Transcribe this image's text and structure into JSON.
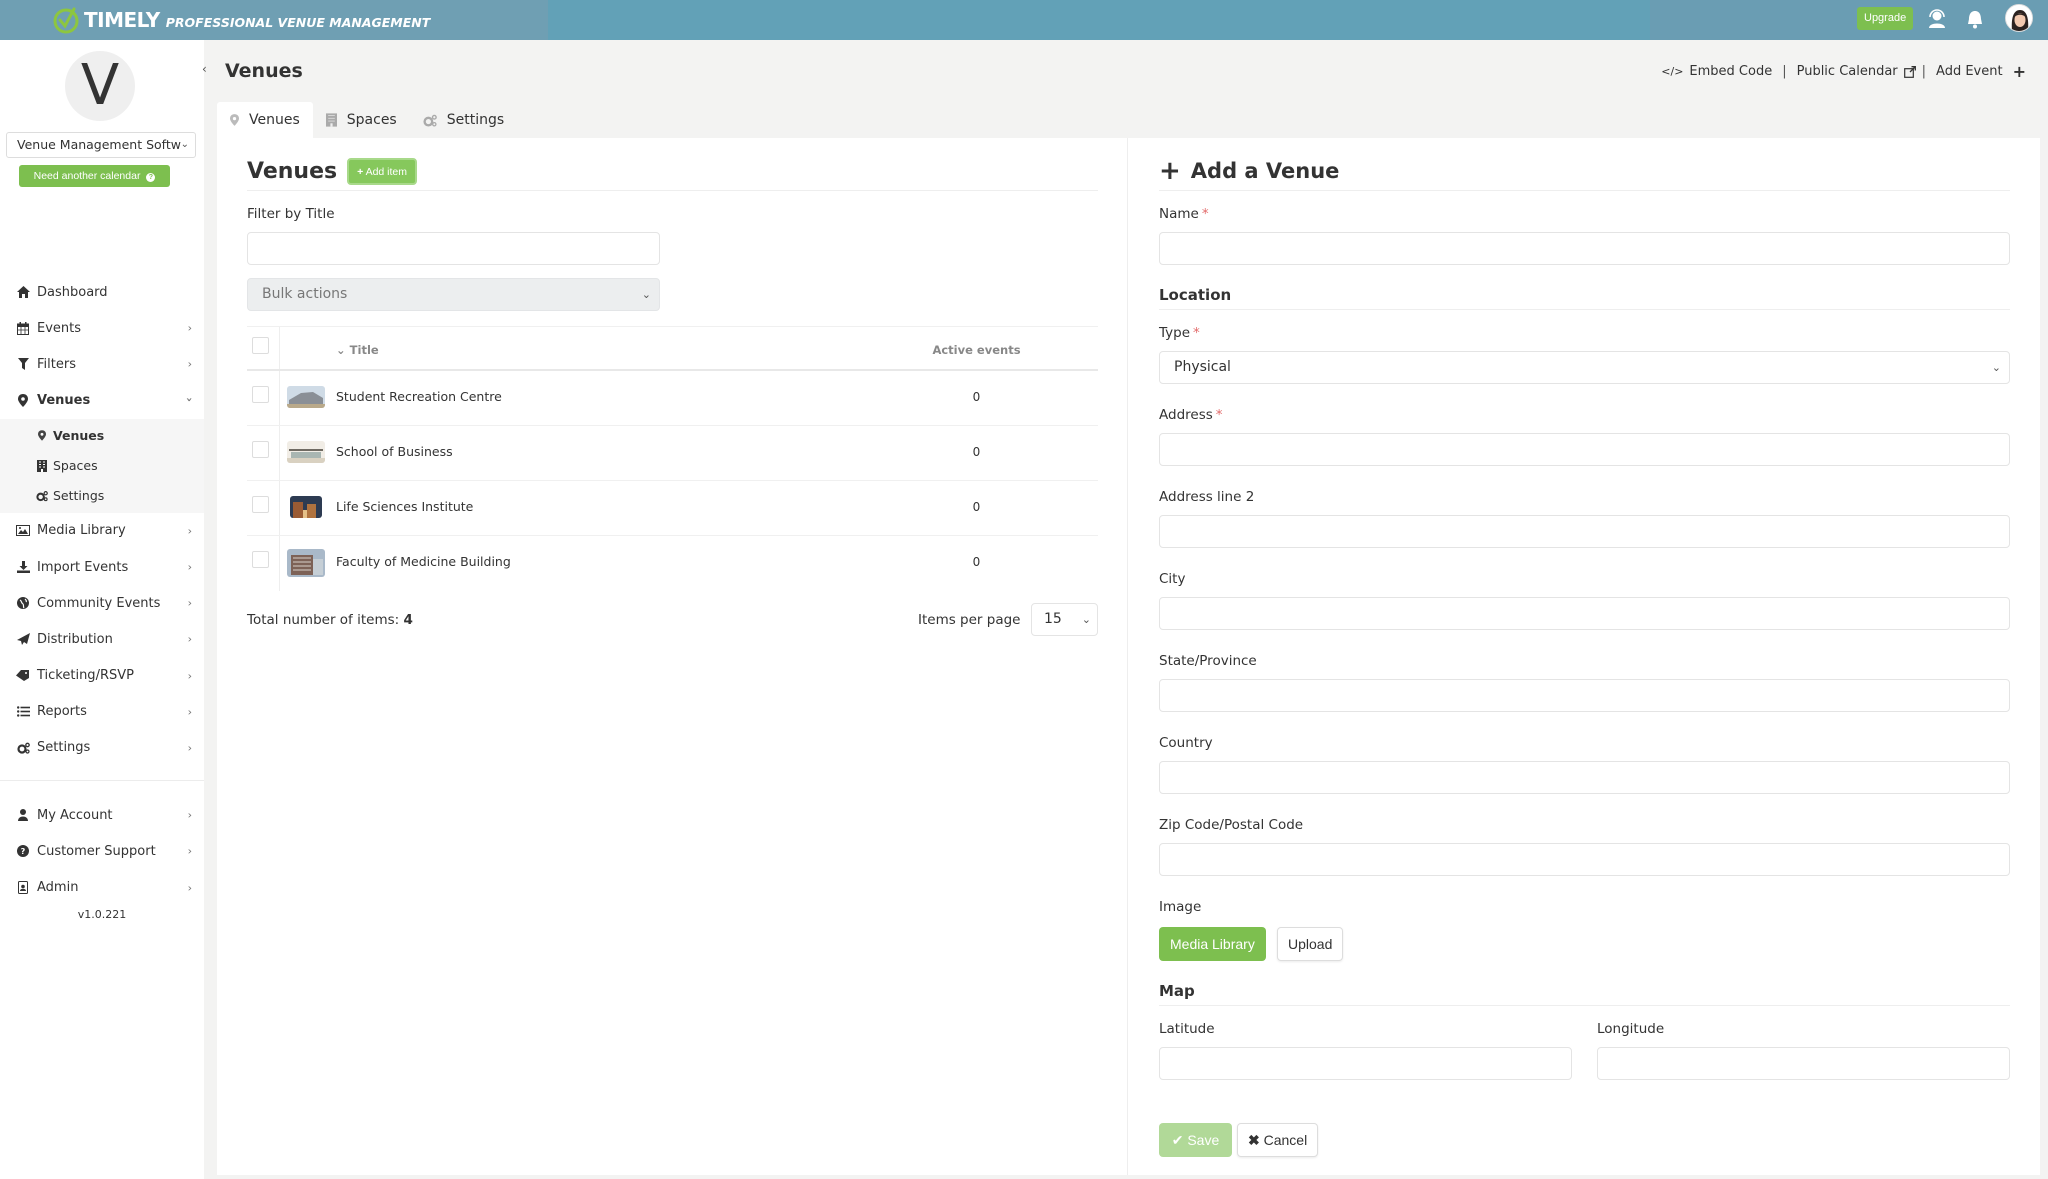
{
  "app": {
    "brand": "TIMELY",
    "tagline": "PROFESSIONAL VENUE MANAGEMENT",
    "upgrade_label": "Upgrade",
    "colors": {
      "topbar": "#62a1b7",
      "accent_green": "#7dbf4f",
      "required": "#e26a6a"
    }
  },
  "sidebar": {
    "avatar_letter": "V",
    "calendar_select": "Venue Management Softw",
    "need_calendar_label": "Need another calendar",
    "items": [
      {
        "label": "Dashboard",
        "icon": "home-icon",
        "has_chevron": false
      },
      {
        "label": "Events",
        "icon": "calendar-icon",
        "has_chevron": true
      },
      {
        "label": "Filters",
        "icon": "filter-icon",
        "has_chevron": true
      },
      {
        "label": "Venues",
        "icon": "map-marker-icon",
        "expanded": true
      },
      {
        "label": "Media Library",
        "icon": "image-icon",
        "has_chevron": true
      },
      {
        "label": "Import Events",
        "icon": "download-icon",
        "has_chevron": true
      },
      {
        "label": "Community Events",
        "icon": "globe-icon",
        "has_chevron": true
      },
      {
        "label": "Distribution",
        "icon": "paper-plane-icon",
        "has_chevron": true
      },
      {
        "label": "Ticketing/RSVP",
        "icon": "tags-icon",
        "has_chevron": true
      },
      {
        "label": "Reports",
        "icon": "list-icon",
        "has_chevron": true
      },
      {
        "label": "Settings",
        "icon": "cogs-icon",
        "has_chevron": true
      }
    ],
    "venues_sub": [
      {
        "label": "Venues",
        "icon": "map-marker-icon",
        "active": true
      },
      {
        "label": "Spaces",
        "icon": "building-icon"
      },
      {
        "label": "Settings",
        "icon": "cogs-icon"
      }
    ],
    "bottom_items": [
      {
        "label": "My Account",
        "icon": "user-icon"
      },
      {
        "label": "Customer Support",
        "icon": "question-circle-icon"
      },
      {
        "label": "Admin",
        "icon": "id-badge-icon"
      }
    ],
    "version": "v1.0.221"
  },
  "header": {
    "title": "Venues",
    "embed_code": "Embed Code",
    "public_calendar": "Public Calendar",
    "add_event": "Add Event",
    "separator": "|"
  },
  "tabs": [
    {
      "label": "Venues",
      "icon": "map-marker-icon",
      "active": true
    },
    {
      "label": "Spaces",
      "icon": "building-icon"
    },
    {
      "label": "Settings",
      "icon": "cogs-icon"
    }
  ],
  "list": {
    "heading": "Venues",
    "add_item_label": "Add item",
    "filter_label": "Filter by Title",
    "filter_value": "",
    "bulk_actions": "Bulk actions",
    "columns": {
      "title": "Title",
      "active_events": "Active events"
    },
    "rows": [
      {
        "title": "Student Recreation Centre",
        "active_events": "0"
      },
      {
        "title": "School of Business",
        "active_events": "0"
      },
      {
        "title": "Life Sciences Institute",
        "active_events": "0"
      },
      {
        "title": "Faculty of Medicine Building",
        "active_events": "0"
      }
    ],
    "total_label": "Total number of items:",
    "total_value": "4",
    "items_per_page_label": "Items per page",
    "items_per_page": "15"
  },
  "form": {
    "title": "Add a Venue",
    "name_label": "Name",
    "name_value": "",
    "location_heading": "Location",
    "type_label": "Type",
    "type_value": "Physical",
    "address_label": "Address",
    "address_value": "",
    "address2_label": "Address line 2",
    "address2_value": "",
    "city_label": "City",
    "city_value": "",
    "state_label": "State/Province",
    "state_value": "",
    "country_label": "Country",
    "country_value": "",
    "zip_label": "Zip Code/Postal Code",
    "zip_value": "",
    "image_label": "Image",
    "media_library_label": "Media Library",
    "upload_label": "Upload",
    "map_heading": "Map",
    "latitude_label": "Latitude",
    "latitude_value": "",
    "longitude_label": "Longitude",
    "longitude_value": "",
    "save_label": "Save",
    "cancel_label": "Cancel",
    "required_mark": "*"
  }
}
